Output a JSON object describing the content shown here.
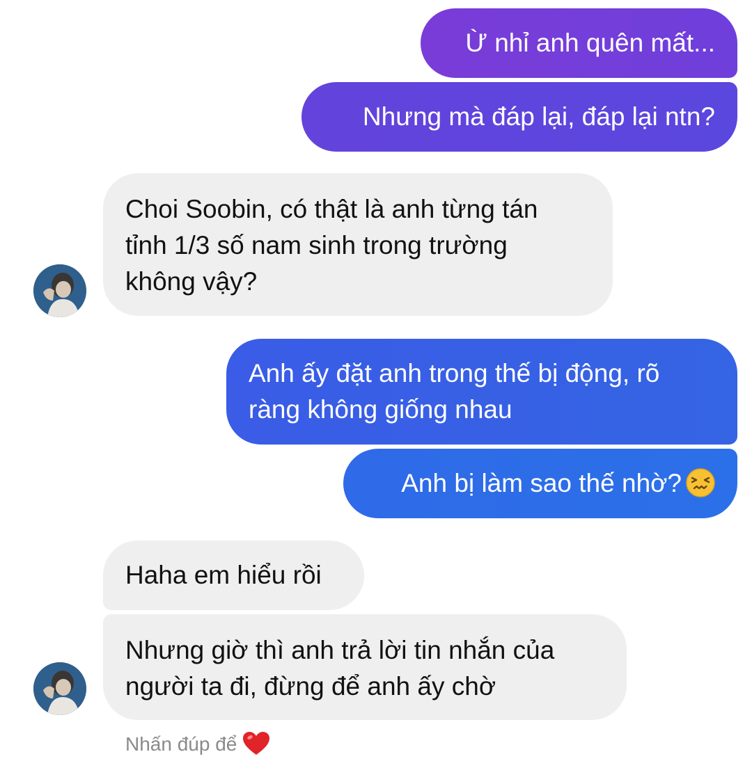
{
  "messages": [
    {
      "side": "sent",
      "lines": [
        "Ừ nhỉ anh quên mất..."
      ]
    },
    {
      "side": "sent",
      "lines": [
        "Nhưng mà đáp lại, đáp lại ntn?"
      ]
    },
    {
      "side": "received",
      "lines": [
        "Choi Soobin, có thật là anh từng tán",
        "tỉnh 1/3 số nam sinh trong trường",
        "không vậy?"
      ]
    },
    {
      "side": "sent",
      "lines": [
        "Anh ấy đặt anh trong thế bị động, rõ",
        "ràng không giống nhau"
      ]
    },
    {
      "side": "sent",
      "lines": [
        "Anh bị làm sao thế nhờ?"
      ],
      "emoji": "confounded-face-emoji"
    },
    {
      "side": "received",
      "lines": [
        "Haha em hiểu rồi"
      ]
    },
    {
      "side": "received",
      "lines": [
        "Nhưng giờ thì anh trả lời tin nhắn của",
        "người ta đi, đừng để anh ấy chờ"
      ]
    }
  ],
  "double_tap_hint": {
    "text": "Nhấn đúp để",
    "icon": "heart-icon"
  },
  "colors": {
    "sent_top": "#7a3cd8",
    "sent_bottom": "#2b70e8",
    "received_bg": "#efefef",
    "hint_text": "#8a8a8a",
    "heart": "#e0242a"
  }
}
